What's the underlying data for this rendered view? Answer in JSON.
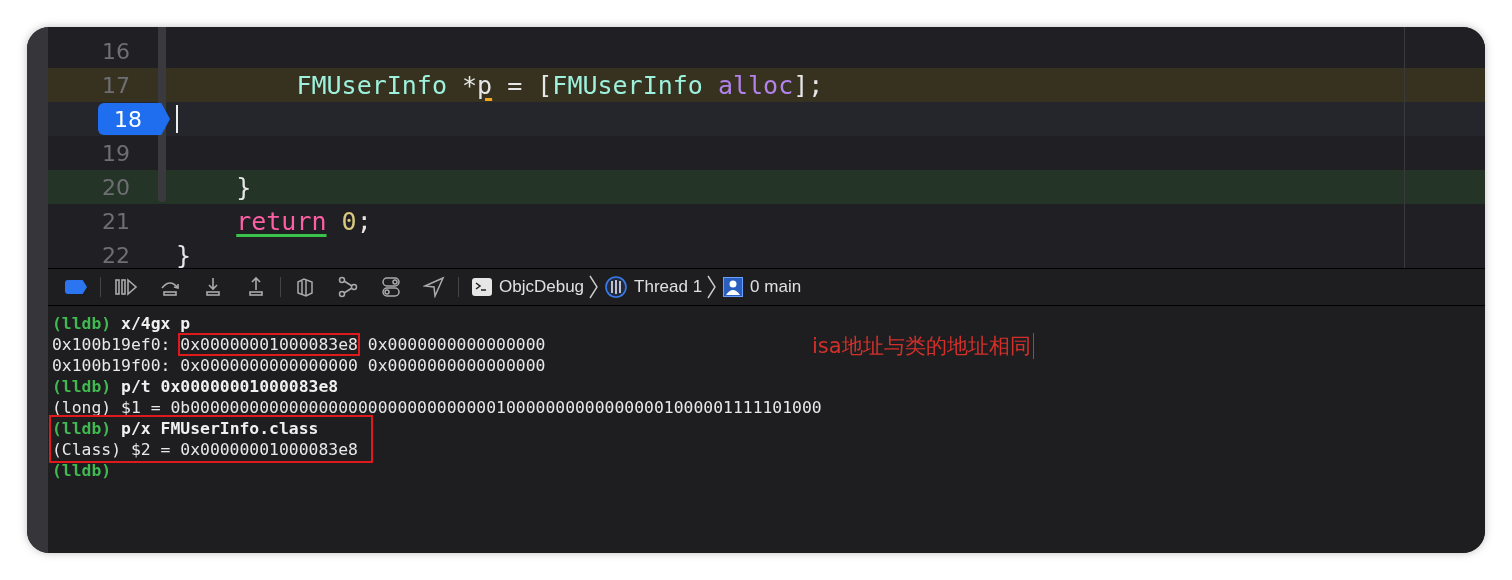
{
  "editor": {
    "lines": [
      {
        "number": "16"
      },
      {
        "number": "17",
        "color": "#36321f",
        "tokens": [
          {
            "text": "        FMUserInfo",
            "kind": "type"
          },
          {
            "text": " *",
            "kind": "plain"
          },
          {
            "text": "p",
            "kind": "plain",
            "warning": true
          },
          {
            "text": " = [",
            "kind": "plain"
          },
          {
            "text": "FMUserInfo",
            "kind": "type"
          },
          {
            "text": " alloc",
            "kind": "method"
          },
          {
            "text": "];",
            "kind": "plain"
          }
        ]
      },
      {
        "number": "18",
        "color": "#24262c",
        "breakpoint": true,
        "cursor": true
      },
      {
        "number": "19"
      },
      {
        "number": "20",
        "color": "#243426",
        "tokens": [
          {
            "text": "    }",
            "kind": "plain"
          }
        ]
      },
      {
        "number": "21",
        "tokens": [
          {
            "text": "    return",
            "kind": "keyword",
            "issue": true
          },
          {
            "text": " 0",
            "kind": "number"
          },
          {
            "text": ";",
            "kind": "plain"
          }
        ]
      },
      {
        "number": "22",
        "tokens": [
          {
            "text": "}",
            "kind": "plain"
          }
        ]
      }
    ]
  },
  "debug_bar": {
    "breakpoints_active": true,
    "path": [
      "ObjcDebug",
      "Thread 1",
      "0 main"
    ]
  },
  "console": {
    "blocks": [
      {
        "lines": [
          [
            {
              "text": "(lldb)",
              "kind": "prompt"
            },
            {
              "text": " x/4gx p",
              "kind": "command"
            }
          ],
          [
            {
              "text": "0x100b19ef0: ",
              "kind": "output"
            },
            {
              "text": "0x00000001000083e8",
              "kind": "output",
              "boxed": true
            },
            {
              "text": " 0x0000000000000000",
              "kind": "output"
            }
          ],
          [
            {
              "text": "0x100b19f00: 0x0000000000000000 0x0000000000000000",
              "kind": "output"
            }
          ],
          [
            {
              "text": "(lldb)",
              "kind": "prompt"
            },
            {
              "text": " p/t 0x00000001000083e8",
              "kind": "command"
            }
          ],
          [
            {
              "text": "(long) $1 = 0b0000000000000000000000000000000100000000000000001000001111101000",
              "kind": "output"
            }
          ]
        ]
      },
      {
        "boxed": true,
        "lines": [
          [
            {
              "text": "(lldb)",
              "kind": "prompt"
            },
            {
              "text": " p/x FMUserInfo.class",
              "kind": "command"
            }
          ],
          [
            {
              "text": "(Class) $2 = 0x00000001000083e8",
              "kind": "output"
            }
          ]
        ]
      },
      {
        "lines": [
          [
            {
              "text": "(lldb)",
              "kind": "prompt"
            }
          ]
        ]
      }
    ],
    "annotation": "isa地址与类的地址相同"
  }
}
